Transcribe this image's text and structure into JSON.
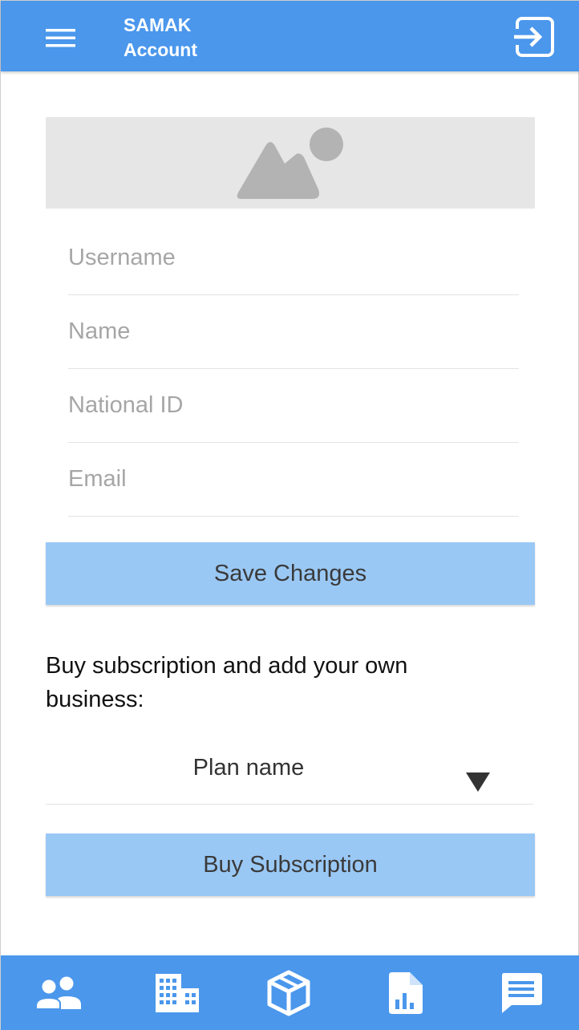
{
  "header": {
    "title_line1": "SAMAK",
    "title_line2": "Account",
    "menu_icon": "hamburger-menu-icon",
    "logout_icon": "logout-icon"
  },
  "profile_image": {
    "icon": "image-placeholder-icon"
  },
  "form": {
    "username_placeholder": "Username",
    "name_placeholder": "Name",
    "national_id_placeholder": "National ID",
    "email_placeholder": "Email",
    "save_label": "Save Changes"
  },
  "subscription": {
    "prompt": "Buy subscription and add your own business:",
    "plan_selected": "Plan name",
    "buy_label": "Buy Subscription"
  },
  "bottom_nav": {
    "items": [
      {
        "icon": "people-icon"
      },
      {
        "icon": "building-icon"
      },
      {
        "icon": "package-icon"
      },
      {
        "icon": "report-icon"
      },
      {
        "icon": "chat-icon"
      }
    ]
  },
  "colors": {
    "primary": "#4a97ec",
    "button": "#9ac8f5",
    "placeholder_bg": "#e6e6e6"
  }
}
